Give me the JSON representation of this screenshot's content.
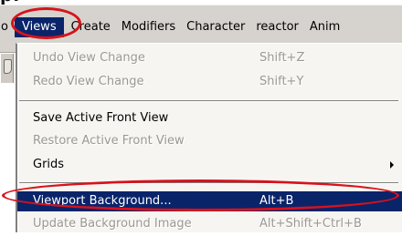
{
  "heading": "p.",
  "menubar": {
    "items": [
      {
        "label": "o",
        "active": false
      },
      {
        "label": "Views",
        "active": true
      },
      {
        "label": "Create",
        "active": false
      },
      {
        "label": "Modifiers",
        "active": false
      },
      {
        "label": "Character",
        "active": false
      },
      {
        "label": "reactor",
        "active": false
      },
      {
        "label": "Anim",
        "active": false
      }
    ]
  },
  "views_menu": {
    "items": [
      {
        "label": "Undo View Change",
        "shortcut": "Shift+Z",
        "enabled": false
      },
      {
        "label": "Redo View Change",
        "shortcut": "Shift+Y",
        "enabled": false
      },
      {
        "label": "Save Active Front View",
        "shortcut": "",
        "enabled": true
      },
      {
        "label": "Restore Active Front View",
        "shortcut": "",
        "enabled": false
      },
      {
        "label": "Grids",
        "shortcut": "",
        "enabled": true,
        "has_submenu": true
      },
      {
        "label": "Viewport Background...",
        "shortcut": "Alt+B",
        "enabled": true,
        "selected": true
      },
      {
        "label": "Update Background Image",
        "shortcut": "Alt+Shift+Ctrl+B",
        "enabled": false
      }
    ]
  },
  "colors": {
    "menubar_bg": "#d6d3ce",
    "menu_bg": "#f6f5f2",
    "selection_bg": "#0a246a",
    "disabled_text": "#9a9893",
    "annotation_ring": "#d8121b"
  }
}
